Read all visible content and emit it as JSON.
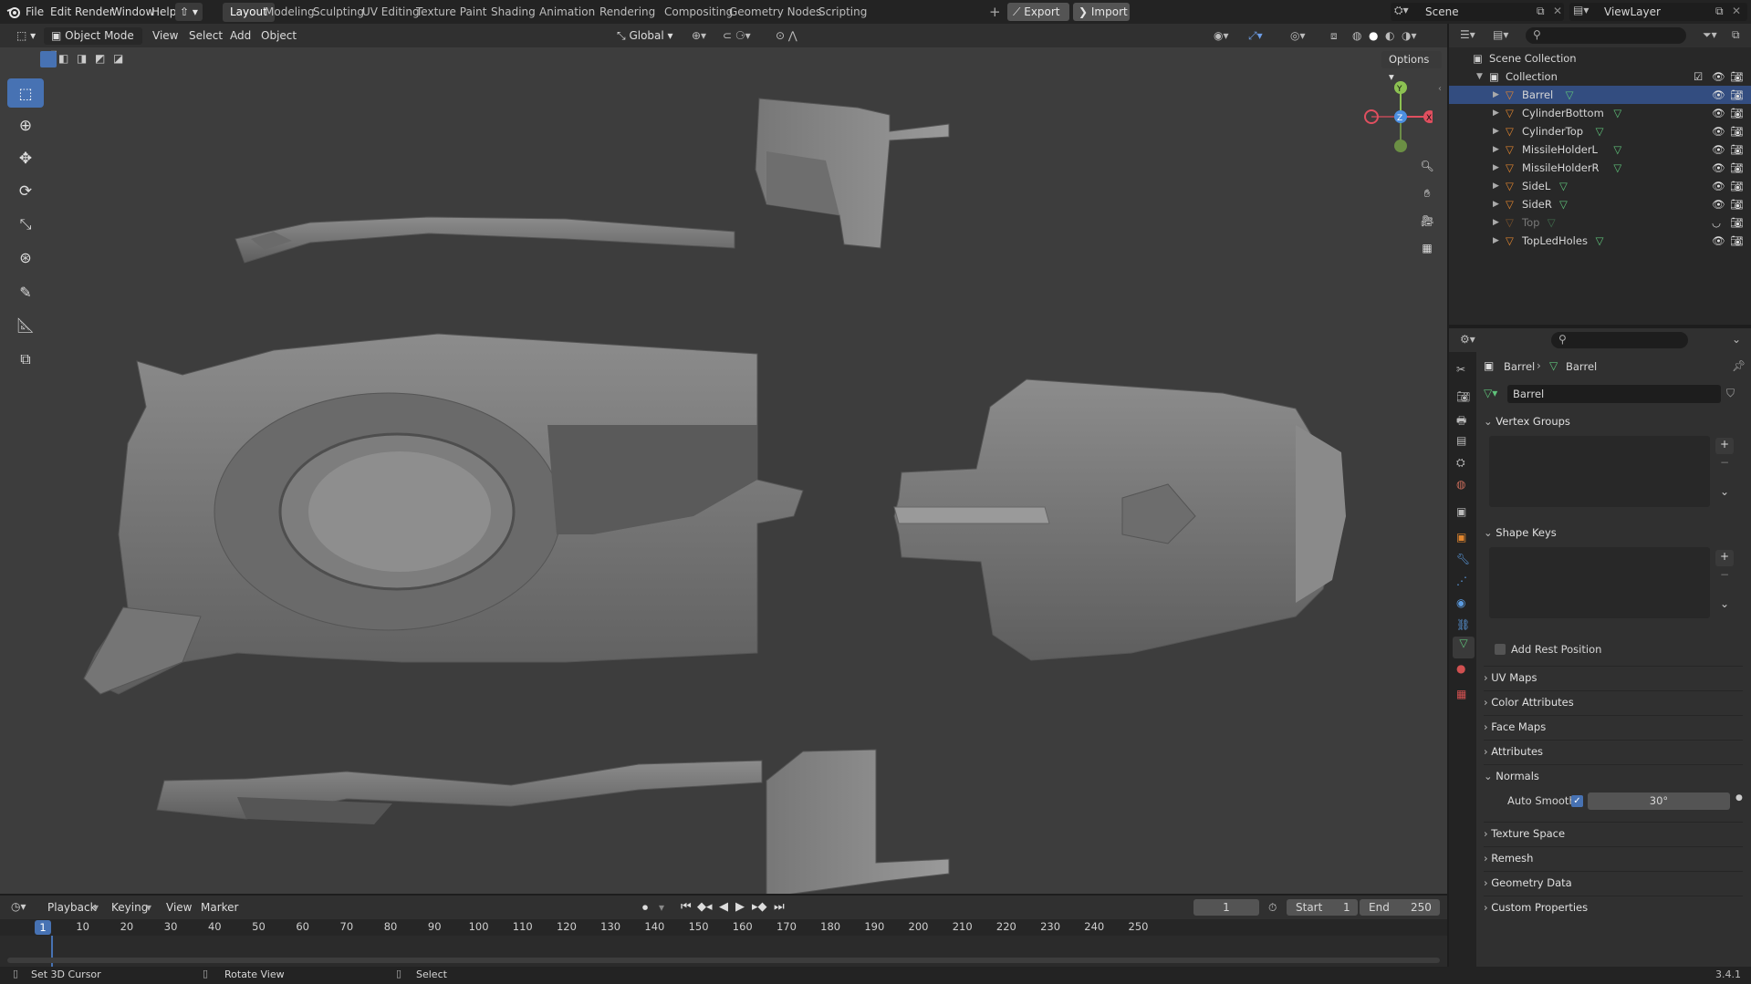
{
  "topbar": {
    "menus": [
      "File",
      "Edit",
      "Render",
      "Window",
      "Help"
    ],
    "workspaces": [
      "Layout",
      "Modeling",
      "Sculpting",
      "UV Editing",
      "Texture Paint",
      "Shading",
      "Animation",
      "Rendering",
      "Compositing",
      "Geometry Nodes",
      "Scripting"
    ],
    "active_workspace": "Layout",
    "export_label": "Export",
    "import_label": "Import",
    "scene": "Scene",
    "view_layer": "ViewLayer"
  },
  "viewport_header": {
    "mode": "Object Mode",
    "menus": [
      "View",
      "Select",
      "Add",
      "Object"
    ],
    "transform_orientation": "Global",
    "options_label": "Options"
  },
  "gizmo": {
    "x": "X",
    "y": "Y",
    "z": "Z"
  },
  "outliner": {
    "root": "Scene Collection",
    "collection": "Collection",
    "objects": [
      {
        "name": "Barrel",
        "selected": true,
        "visible": true
      },
      {
        "name": "CylinderBottom",
        "selected": false,
        "visible": true
      },
      {
        "name": "CylinderTop",
        "selected": false,
        "visible": true
      },
      {
        "name": "MissileHolderL",
        "selected": false,
        "visible": true
      },
      {
        "name": "MissileHolderR",
        "selected": false,
        "visible": true
      },
      {
        "name": "SideL",
        "selected": false,
        "visible": true
      },
      {
        "name": "SideR",
        "selected": false,
        "visible": true
      },
      {
        "name": "Top",
        "selected": false,
        "visible": false
      },
      {
        "name": "TopLedHoles",
        "selected": false,
        "visible": true
      }
    ]
  },
  "properties": {
    "breadcrumb_object": "Barrel",
    "breadcrumb_mesh": "Barrel",
    "mesh_name": "Barrel",
    "vertex_groups": "Vertex Groups",
    "shape_keys": "Shape Keys",
    "add_rest_position": "Add Rest Position",
    "uv_maps": "UV Maps",
    "color_attributes": "Color Attributes",
    "face_maps": "Face Maps",
    "attributes": "Attributes",
    "normals": "Normals",
    "auto_smooth_label": "Auto Smooth",
    "auto_smooth_angle": "30°",
    "texture_space": "Texture Space",
    "remesh": "Remesh",
    "geometry_data": "Geometry Data",
    "custom_properties": "Custom Properties"
  },
  "timeline": {
    "menus": [
      "Playback",
      "Keying",
      "View",
      "Marker"
    ],
    "current_frame": "1",
    "start_label": "Start",
    "start": "1",
    "end_label": "End",
    "end": "250",
    "ticks": [
      "1",
      "10",
      "20",
      "30",
      "40",
      "50",
      "60",
      "70",
      "80",
      "90",
      "100",
      "110",
      "120",
      "130",
      "140",
      "150",
      "160",
      "170",
      "180",
      "190",
      "200",
      "210",
      "220",
      "230",
      "240",
      "250"
    ]
  },
  "statusbar": {
    "hint1": "Set 3D Cursor",
    "hint2": "Rotate View",
    "hint3": "Select",
    "version": "3.4.1"
  },
  "colors": {
    "accent": "#4772b3",
    "selection": "#334d80",
    "mesh_orange": "#e0852e",
    "mesh_green": "#5fc27a"
  }
}
